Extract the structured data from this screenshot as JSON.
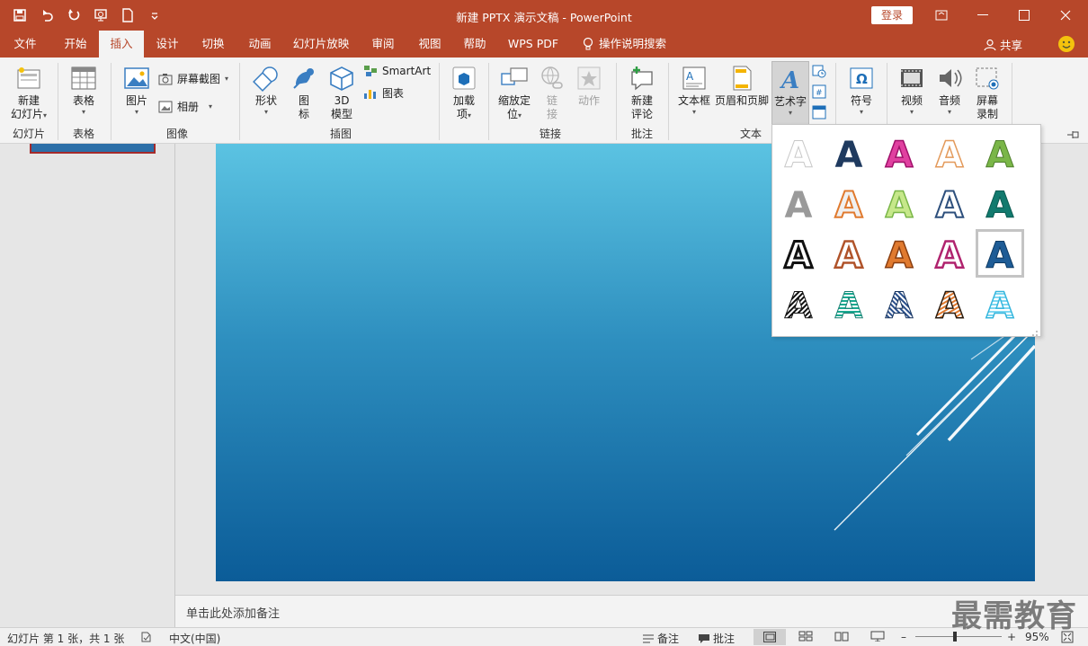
{
  "window": {
    "title": "新建 PPTX 演示文稿 - PowerPoint",
    "login": "登录"
  },
  "tabs": [
    "文件",
    "开始",
    "插入",
    "设计",
    "切换",
    "动画",
    "幻灯片放映",
    "审阅",
    "视图",
    "帮助",
    "WPS PDF",
    "操作说明搜索"
  ],
  "active_tab": "插入",
  "share": "共享",
  "ribbon": {
    "new_slide": [
      "新建",
      "幻灯片"
    ],
    "table": "表格",
    "picture": "图片",
    "screenshot": "屏幕截图",
    "album": "相册",
    "shapes": "形状",
    "icons": [
      "图",
      "标"
    ],
    "model3d": [
      "3D",
      "模型"
    ],
    "smartart": "SmartArt",
    "chart": "图表",
    "addins": [
      "加载",
      "项"
    ],
    "zoom": [
      "缩放定",
      "位"
    ],
    "link": [
      "链",
      "接"
    ],
    "action": "动作",
    "new_comment": [
      "新建",
      "评论"
    ],
    "textbox": "文本框",
    "header_footer": "页眉和页脚",
    "wordart": "艺术字",
    "symbol": "符号",
    "video": "视频",
    "audio": "音频",
    "screen_record": [
      "屏幕",
      "录制"
    ],
    "groups": {
      "slides": "幻灯片",
      "tables": "表格",
      "images": "图像",
      "illustrations": "插图",
      "links": "链接",
      "comments": "批注",
      "text": "文本"
    }
  },
  "gallery": {
    "glyph": "A",
    "selected_index": 14
  },
  "notes_placeholder": "单击此处添加备注",
  "status": {
    "slide_info": "幻灯片 第 1 张，共 1 张",
    "language": "中文(中国)",
    "notes": "备注",
    "comments": "批注",
    "zoom": "95%"
  },
  "watermark": "最需教育",
  "colors": {
    "accent": "#b7472a",
    "ribbon_bg": "#f3f3f3"
  }
}
